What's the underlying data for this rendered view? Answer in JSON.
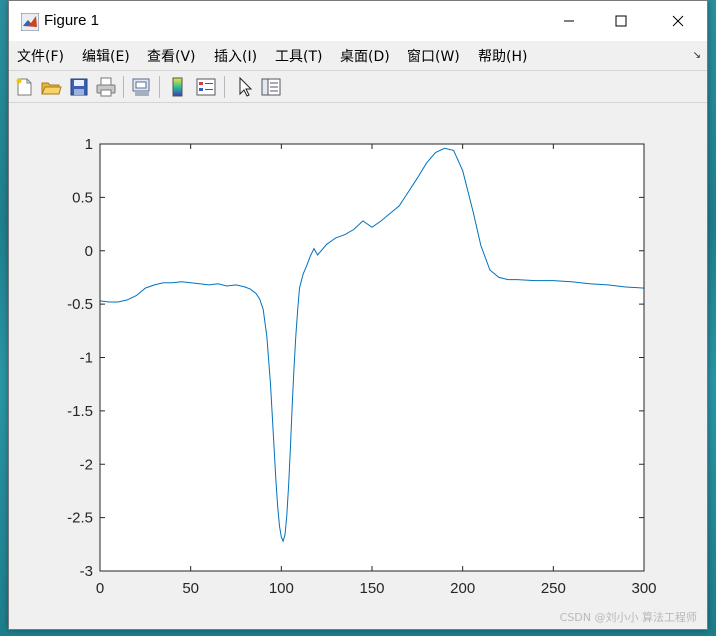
{
  "window": {
    "title": "Figure 1",
    "icon": "matlab-logo-icon"
  },
  "menu": [
    {
      "label": "文件(F)"
    },
    {
      "label": "编辑(E)"
    },
    {
      "label": "查看(V)"
    },
    {
      "label": "插入(I)"
    },
    {
      "label": "工具(T)"
    },
    {
      "label": "桌面(D)"
    },
    {
      "label": "窗口(W)"
    },
    {
      "label": "帮助(H)"
    }
  ],
  "toolbar": [
    {
      "icon": "new-figure-icon"
    },
    {
      "icon": "open-file-icon"
    },
    {
      "icon": "save-icon"
    },
    {
      "icon": "print-icon"
    },
    {
      "icon": "link-plot-icon"
    },
    {
      "icon": "colorbar-icon"
    },
    {
      "icon": "legend-icon"
    },
    {
      "icon": "pointer-icon"
    },
    {
      "icon": "property-inspector-icon"
    }
  ],
  "watermark": "CSDN @刘小小 算法工程师",
  "chart_data": {
    "type": "line",
    "title": "",
    "xlabel": "",
    "ylabel": "",
    "xlim": [
      0,
      300
    ],
    "ylim": [
      -3,
      1
    ],
    "xticks": [
      "0",
      "50",
      "100",
      "150",
      "200",
      "250",
      "300"
    ],
    "yticks": [
      "1",
      "0.5",
      "0",
      "-0.5",
      "-1",
      "-1.5",
      "-2",
      "-2.5",
      "-3"
    ],
    "grid": false,
    "line_color": "#0072BD",
    "series": [
      {
        "x": [
          0,
          5,
          10,
          15,
          20,
          25,
          30,
          35,
          40,
          45,
          50,
          55,
          60,
          65,
          70,
          75,
          80,
          83,
          86,
          88,
          90,
          92,
          94,
          95,
          96,
          97,
          98,
          99,
          100,
          101,
          102,
          103,
          104,
          105,
          106,
          107,
          108,
          109,
          110,
          112,
          114,
          116,
          118,
          120,
          125,
          130,
          135,
          140,
          145,
          150,
          155,
          160,
          165,
          170,
          175,
          180,
          185,
          190,
          195,
          200,
          203,
          206,
          210,
          215,
          220,
          225,
          230,
          240,
          250,
          260,
          270,
          280,
          290,
          300
        ],
        "y": [
          -0.47,
          -0.48,
          -0.48,
          -0.46,
          -0.42,
          -0.35,
          -0.32,
          -0.3,
          -0.3,
          -0.29,
          -0.3,
          -0.31,
          -0.32,
          -0.31,
          -0.33,
          -0.32,
          -0.34,
          -0.36,
          -0.4,
          -0.45,
          -0.55,
          -0.8,
          -1.25,
          -1.55,
          -1.85,
          -2.15,
          -2.4,
          -2.58,
          -2.68,
          -2.72,
          -2.66,
          -2.48,
          -2.2,
          -1.85,
          -1.45,
          -1.1,
          -0.8,
          -0.55,
          -0.35,
          -0.22,
          -0.14,
          -0.05,
          0.02,
          -0.04,
          0.06,
          0.12,
          0.15,
          0.2,
          0.28,
          0.22,
          0.28,
          0.35,
          0.42,
          0.55,
          0.68,
          0.82,
          0.92,
          0.96,
          0.94,
          0.75,
          0.55,
          0.35,
          0.05,
          -0.18,
          -0.25,
          -0.27,
          -0.27,
          -0.28,
          -0.28,
          -0.29,
          -0.31,
          -0.32,
          -0.34,
          -0.35
        ]
      }
    ]
  }
}
